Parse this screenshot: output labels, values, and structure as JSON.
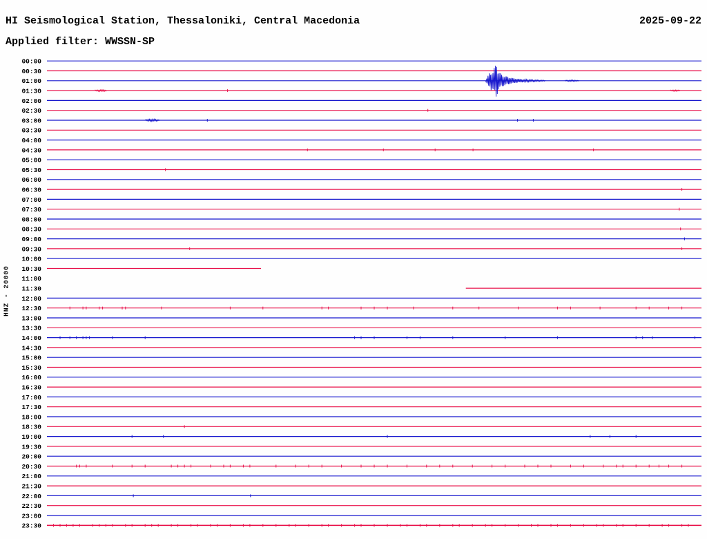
{
  "header": {
    "station_title": "HI Seismological Station, Thessaloniki, Central Macedonia",
    "date": "2025-09-22",
    "filter_label": "Applied filter: WWSSN-SP",
    "channel_label": "HNZ - 20000"
  },
  "chart_data": {
    "type": "line",
    "subtype": "helicorder-seismogram",
    "title": "HI Seismological Station, Thessaloniki, Central Macedonia",
    "date": "2025-09-22",
    "filter": "WWSSN-SP",
    "channel": "HNZ",
    "gain": "20000",
    "row_duration_minutes": 30,
    "legend_position": "none",
    "grid": false,
    "colors": {
      "b": "#1717cd",
      "r": "#e8114a"
    },
    "rows": [
      {
        "t": "00:00",
        "c": "b"
      },
      {
        "t": "00:30",
        "c": "r"
      },
      {
        "t": "01:00",
        "c": "b"
      },
      {
        "t": "01:30",
        "c": "r",
        "ticks": [
          0.276
        ]
      },
      {
        "t": "02:00",
        "c": "b"
      },
      {
        "t": "02:30",
        "c": "r",
        "ticks": [
          0.582
        ]
      },
      {
        "t": "03:00",
        "c": "b",
        "ticks": [
          0.245,
          0.719,
          0.743
        ]
      },
      {
        "t": "03:30",
        "c": "r"
      },
      {
        "t": "04:00",
        "c": "b"
      },
      {
        "t": "04:30",
        "c": "r",
        "ticks": [
          0.398,
          0.514,
          0.593,
          0.651,
          0.835
        ]
      },
      {
        "t": "05:00",
        "c": "b"
      },
      {
        "t": "05:30",
        "c": "r",
        "ticks": [
          0.181
        ]
      },
      {
        "t": "06:00",
        "c": "b"
      },
      {
        "t": "06:30",
        "c": "r",
        "ticks": [
          0.97
        ]
      },
      {
        "t": "07:00",
        "c": "b"
      },
      {
        "t": "07:30",
        "c": "r",
        "ticks": [
          0.966
        ]
      },
      {
        "t": "08:00",
        "c": "b"
      },
      {
        "t": "08:30",
        "c": "r",
        "ticks": [
          0.968
        ]
      },
      {
        "t": "09:00",
        "c": "b",
        "ticks": [
          0.974
        ]
      },
      {
        "t": "09:30",
        "c": "r",
        "ticks": [
          0.218,
          0.97
        ]
      },
      {
        "t": "10:00",
        "c": "b"
      },
      {
        "t": "10:30",
        "c": "r",
        "seg": [
          [
            0,
            0.327
          ]
        ]
      },
      {
        "t": "11:00",
        "c": "b",
        "seg": []
      },
      {
        "t": "11:30",
        "c": "r",
        "seg": [
          [
            0.64,
            1
          ]
        ]
      },
      {
        "t": "12:00",
        "c": "b"
      },
      {
        "t": "12:30",
        "c": "r",
        "ticks": [
          0.035,
          0.055,
          0.06,
          0.08,
          0.085,
          0.115,
          0.12,
          0.175,
          0.28,
          0.33,
          0.42,
          0.43,
          0.48,
          0.5,
          0.52,
          0.56,
          0.62,
          0.66,
          0.72,
          0.78,
          0.8,
          0.845,
          0.9,
          0.92,
          0.95,
          0.97
        ]
      },
      {
        "t": "13:00",
        "c": "b"
      },
      {
        "t": "13:30",
        "c": "r"
      },
      {
        "t": "14:00",
        "c": "b",
        "ticks": [
          0.02,
          0.035,
          0.045,
          0.055,
          0.06,
          0.065,
          0.1,
          0.15,
          0.47,
          0.48,
          0.5,
          0.55,
          0.57,
          0.62,
          0.7,
          0.78,
          0.9,
          0.91,
          0.925,
          0.99
        ]
      },
      {
        "t": "14:30",
        "c": "r"
      },
      {
        "t": "15:00",
        "c": "b"
      },
      {
        "t": "15:30",
        "c": "r"
      },
      {
        "t": "16:00",
        "c": "b"
      },
      {
        "t": "16:30",
        "c": "r"
      },
      {
        "t": "17:00",
        "c": "b"
      },
      {
        "t": "17:30",
        "c": "r"
      },
      {
        "t": "18:00",
        "c": "b"
      },
      {
        "t": "18:30",
        "c": "r",
        "ticks": [
          0.21
        ]
      },
      {
        "t": "19:00",
        "c": "b",
        "ticks": [
          0.13,
          0.178,
          0.52,
          0.83,
          0.86,
          0.9
        ]
      },
      {
        "t": "19:30",
        "c": "r"
      },
      {
        "t": "20:00",
        "c": "b"
      },
      {
        "t": "20:30",
        "c": "r",
        "ticks": [
          0.045,
          0.05,
          0.06,
          0.1,
          0.13,
          0.15,
          0.19,
          0.2,
          0.21,
          0.22,
          0.25,
          0.27,
          0.28,
          0.3,
          0.31,
          0.35,
          0.38,
          0.4,
          0.42,
          0.45,
          0.48,
          0.5,
          0.52,
          0.55,
          0.58,
          0.6,
          0.62,
          0.65,
          0.68,
          0.7,
          0.73,
          0.75,
          0.77,
          0.8,
          0.82,
          0.85,
          0.87,
          0.88,
          0.9,
          0.92,
          0.935,
          0.95,
          0.97
        ]
      },
      {
        "t": "21:00",
        "c": "b"
      },
      {
        "t": "21:30",
        "c": "r"
      },
      {
        "t": "22:00",
        "c": "b",
        "ticks": [
          0.132,
          0.311
        ]
      },
      {
        "t": "22:30",
        "c": "r"
      },
      {
        "t": "23:00",
        "c": "b"
      },
      {
        "t": "23:30",
        "c": "r",
        "thick": true,
        "ticks": [
          0.01,
          0.02,
          0.03,
          0.04,
          0.05,
          0.07,
          0.08,
          0.09,
          0.1,
          0.12,
          0.13,
          0.15,
          0.16,
          0.17,
          0.19,
          0.2,
          0.22,
          0.23,
          0.25,
          0.26,
          0.28,
          0.3,
          0.31,
          0.33,
          0.35,
          0.37,
          0.38,
          0.4,
          0.42,
          0.43,
          0.45,
          0.47,
          0.48,
          0.5,
          0.52,
          0.54,
          0.55,
          0.57,
          0.58,
          0.6,
          0.62,
          0.63,
          0.65,
          0.67,
          0.68,
          0.7,
          0.72,
          0.74,
          0.75,
          0.77,
          0.78,
          0.8,
          0.82,
          0.84,
          0.85,
          0.87,
          0.88,
          0.9,
          0.92,
          0.94,
          0.95,
          0.97,
          0.98
        ]
      }
    ],
    "events": [
      {
        "row": 2,
        "name": "main-earthquake-burst",
        "env": [
          [
            0.67,
            0.6
          ],
          [
            0.6735,
            6
          ],
          [
            0.675,
            12
          ],
          [
            0.677,
            9
          ],
          [
            0.679,
            15
          ],
          [
            0.681,
            11
          ],
          [
            0.683,
            18
          ],
          [
            0.685,
            22
          ],
          [
            0.6868,
            28
          ],
          [
            0.6885,
            16
          ],
          [
            0.69,
            13
          ],
          [
            0.6925,
            11
          ],
          [
            0.695,
            9
          ],
          [
            0.698,
            7.5
          ],
          [
            0.701,
            6.5
          ],
          [
            0.705,
            5.5
          ],
          [
            0.709,
            4.5
          ],
          [
            0.714,
            3.5
          ],
          [
            0.72,
            2.8
          ],
          [
            0.727,
            2.2
          ],
          [
            0.735,
            1.7
          ],
          [
            0.744,
            1.3
          ],
          [
            0.754,
            1.0
          ],
          [
            0.762,
            0.7
          ]
        ]
      },
      {
        "row": 2,
        "name": "coda-resurgence",
        "env": [
          [
            0.792,
            0.5
          ],
          [
            0.798,
            1.0
          ],
          [
            0.806,
            1.0
          ],
          [
            0.813,
            0.5
          ]
        ]
      },
      {
        "row": 6,
        "name": "small-blip",
        "env": [
          [
            0.151,
            0.7
          ],
          [
            0.156,
            1.6
          ],
          [
            0.164,
            1.6
          ],
          [
            0.172,
            0.7
          ]
        ]
      },
      {
        "row": 3,
        "name": "small-noise-left",
        "env": [
          [
            0.074,
            0.6
          ],
          [
            0.08,
            1.3
          ],
          [
            0.086,
            1.3
          ],
          [
            0.092,
            0.6
          ]
        ]
      },
      {
        "row": 3,
        "name": "small-noise-right",
        "env": [
          [
            0.953,
            0.6
          ],
          [
            0.96,
            1.1
          ],
          [
            0.968,
            0.6
          ]
        ]
      }
    ]
  }
}
